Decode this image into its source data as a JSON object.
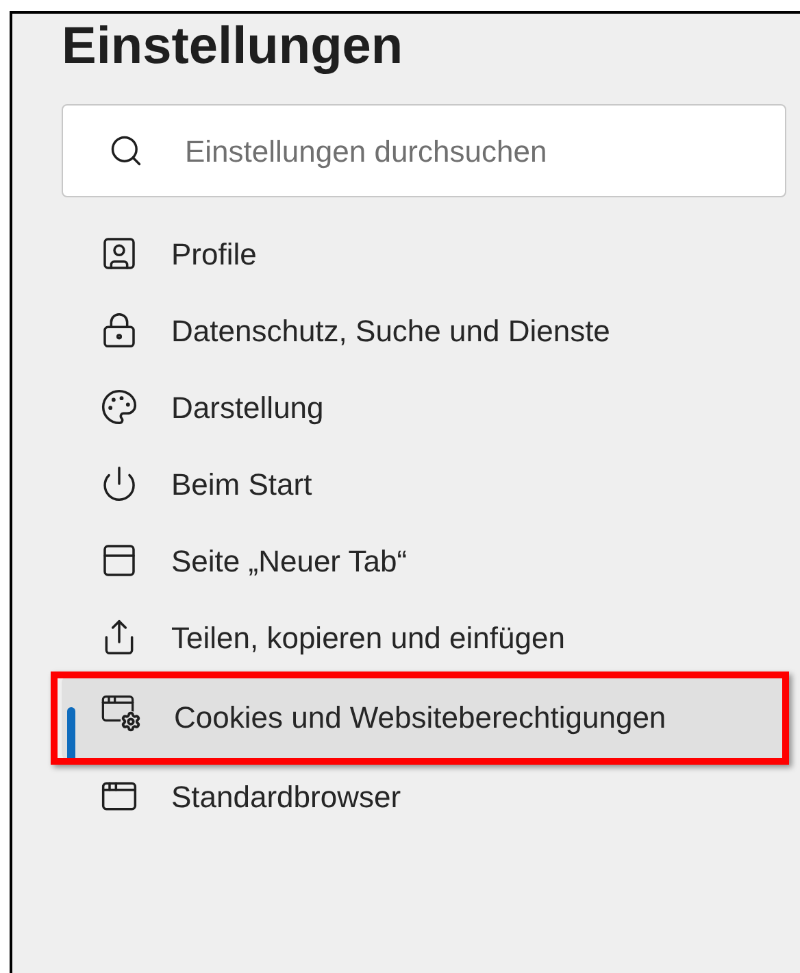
{
  "title": "Einstellungen",
  "search": {
    "placeholder": "Einstellungen durchsuchen"
  },
  "nav": [
    {
      "kind": "profile",
      "label": "Profile",
      "selected": false,
      "highlighted": false
    },
    {
      "kind": "privacy",
      "label": "Datenschutz, Suche und Dienste",
      "selected": false,
      "highlighted": false
    },
    {
      "kind": "appearance",
      "label": "Darstellung",
      "selected": false,
      "highlighted": false
    },
    {
      "kind": "start",
      "label": "Beim Start",
      "selected": false,
      "highlighted": false
    },
    {
      "kind": "newtab",
      "label": "Seite „Neuer Tab“",
      "selected": false,
      "highlighted": false
    },
    {
      "kind": "share",
      "label": "Teilen, kopieren und einfügen",
      "selected": false,
      "highlighted": false
    },
    {
      "kind": "cookies",
      "label": "Cookies und Websiteberechtigungen",
      "selected": true,
      "highlighted": true
    },
    {
      "kind": "browser",
      "label": "Standardbrowser",
      "selected": false,
      "highlighted": false
    }
  ]
}
